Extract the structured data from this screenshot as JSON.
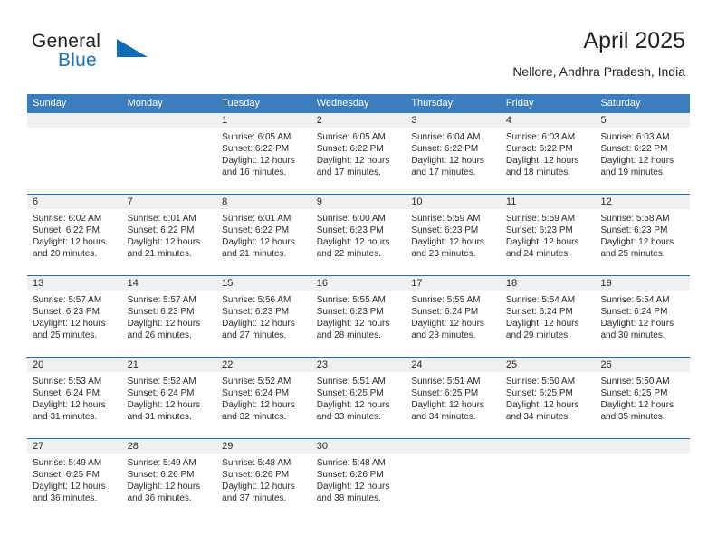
{
  "brand": {
    "name_part1": "General",
    "name_part2": "Blue",
    "flag_icon": "triangle-flag-icon"
  },
  "header": {
    "title": "April 2025",
    "subtitle": "Nellore, Andhra Pradesh, India"
  },
  "colors": {
    "header_blue": "#3b7dbf",
    "rule_blue": "#1f6eb4",
    "band_gray": "#f0f0f0",
    "brand_blue": "#1c72b8",
    "text": "#2a2a2a"
  },
  "weekday_headers": [
    "Sunday",
    "Monday",
    "Tuesday",
    "Wednesday",
    "Thursday",
    "Friday",
    "Saturday"
  ],
  "weeks": [
    [
      {
        "day": "",
        "lines": []
      },
      {
        "day": "",
        "lines": []
      },
      {
        "day": "1",
        "lines": [
          "Sunrise: 6:05 AM",
          "Sunset: 6:22 PM",
          "Daylight: 12 hours",
          "and 16 minutes."
        ]
      },
      {
        "day": "2",
        "lines": [
          "Sunrise: 6:05 AM",
          "Sunset: 6:22 PM",
          "Daylight: 12 hours",
          "and 17 minutes."
        ]
      },
      {
        "day": "3",
        "lines": [
          "Sunrise: 6:04 AM",
          "Sunset: 6:22 PM",
          "Daylight: 12 hours",
          "and 17 minutes."
        ]
      },
      {
        "day": "4",
        "lines": [
          "Sunrise: 6:03 AM",
          "Sunset: 6:22 PM",
          "Daylight: 12 hours",
          "and 18 minutes."
        ]
      },
      {
        "day": "5",
        "lines": [
          "Sunrise: 6:03 AM",
          "Sunset: 6:22 PM",
          "Daylight: 12 hours",
          "and 19 minutes."
        ]
      }
    ],
    [
      {
        "day": "6",
        "lines": [
          "Sunrise: 6:02 AM",
          "Sunset: 6:22 PM",
          "Daylight: 12 hours",
          "and 20 minutes."
        ]
      },
      {
        "day": "7",
        "lines": [
          "Sunrise: 6:01 AM",
          "Sunset: 6:22 PM",
          "Daylight: 12 hours",
          "and 21 minutes."
        ]
      },
      {
        "day": "8",
        "lines": [
          "Sunrise: 6:01 AM",
          "Sunset: 6:22 PM",
          "Daylight: 12 hours",
          "and 21 minutes."
        ]
      },
      {
        "day": "9",
        "lines": [
          "Sunrise: 6:00 AM",
          "Sunset: 6:23 PM",
          "Daylight: 12 hours",
          "and 22 minutes."
        ]
      },
      {
        "day": "10",
        "lines": [
          "Sunrise: 5:59 AM",
          "Sunset: 6:23 PM",
          "Daylight: 12 hours",
          "and 23 minutes."
        ]
      },
      {
        "day": "11",
        "lines": [
          "Sunrise: 5:59 AM",
          "Sunset: 6:23 PM",
          "Daylight: 12 hours",
          "and 24 minutes."
        ]
      },
      {
        "day": "12",
        "lines": [
          "Sunrise: 5:58 AM",
          "Sunset: 6:23 PM",
          "Daylight: 12 hours",
          "and 25 minutes."
        ]
      }
    ],
    [
      {
        "day": "13",
        "lines": [
          "Sunrise: 5:57 AM",
          "Sunset: 6:23 PM",
          "Daylight: 12 hours",
          "and 25 minutes."
        ]
      },
      {
        "day": "14",
        "lines": [
          "Sunrise: 5:57 AM",
          "Sunset: 6:23 PM",
          "Daylight: 12 hours",
          "and 26 minutes."
        ]
      },
      {
        "day": "15",
        "lines": [
          "Sunrise: 5:56 AM",
          "Sunset: 6:23 PM",
          "Daylight: 12 hours",
          "and 27 minutes."
        ]
      },
      {
        "day": "16",
        "lines": [
          "Sunrise: 5:55 AM",
          "Sunset: 6:23 PM",
          "Daylight: 12 hours",
          "and 28 minutes."
        ]
      },
      {
        "day": "17",
        "lines": [
          "Sunrise: 5:55 AM",
          "Sunset: 6:24 PM",
          "Daylight: 12 hours",
          "and 28 minutes."
        ]
      },
      {
        "day": "18",
        "lines": [
          "Sunrise: 5:54 AM",
          "Sunset: 6:24 PM",
          "Daylight: 12 hours",
          "and 29 minutes."
        ]
      },
      {
        "day": "19",
        "lines": [
          "Sunrise: 5:54 AM",
          "Sunset: 6:24 PM",
          "Daylight: 12 hours",
          "and 30 minutes."
        ]
      }
    ],
    [
      {
        "day": "20",
        "lines": [
          "Sunrise: 5:53 AM",
          "Sunset: 6:24 PM",
          "Daylight: 12 hours",
          "and 31 minutes."
        ]
      },
      {
        "day": "21",
        "lines": [
          "Sunrise: 5:52 AM",
          "Sunset: 6:24 PM",
          "Daylight: 12 hours",
          "and 31 minutes."
        ]
      },
      {
        "day": "22",
        "lines": [
          "Sunrise: 5:52 AM",
          "Sunset: 6:24 PM",
          "Daylight: 12 hours",
          "and 32 minutes."
        ]
      },
      {
        "day": "23",
        "lines": [
          "Sunrise: 5:51 AM",
          "Sunset: 6:25 PM",
          "Daylight: 12 hours",
          "and 33 minutes."
        ]
      },
      {
        "day": "24",
        "lines": [
          "Sunrise: 5:51 AM",
          "Sunset: 6:25 PM",
          "Daylight: 12 hours",
          "and 34 minutes."
        ]
      },
      {
        "day": "25",
        "lines": [
          "Sunrise: 5:50 AM",
          "Sunset: 6:25 PM",
          "Daylight: 12 hours",
          "and 34 minutes."
        ]
      },
      {
        "day": "26",
        "lines": [
          "Sunrise: 5:50 AM",
          "Sunset: 6:25 PM",
          "Daylight: 12 hours",
          "and 35 minutes."
        ]
      }
    ],
    [
      {
        "day": "27",
        "lines": [
          "Sunrise: 5:49 AM",
          "Sunset: 6:25 PM",
          "Daylight: 12 hours",
          "and 36 minutes."
        ]
      },
      {
        "day": "28",
        "lines": [
          "Sunrise: 5:49 AM",
          "Sunset: 6:26 PM",
          "Daylight: 12 hours",
          "and 36 minutes."
        ]
      },
      {
        "day": "29",
        "lines": [
          "Sunrise: 5:48 AM",
          "Sunset: 6:26 PM",
          "Daylight: 12 hours",
          "and 37 minutes."
        ]
      },
      {
        "day": "30",
        "lines": [
          "Sunrise: 5:48 AM",
          "Sunset: 6:26 PM",
          "Daylight: 12 hours",
          "and 38 minutes."
        ]
      },
      {
        "day": "",
        "lines": []
      },
      {
        "day": "",
        "lines": []
      },
      {
        "day": "",
        "lines": []
      }
    ]
  ]
}
